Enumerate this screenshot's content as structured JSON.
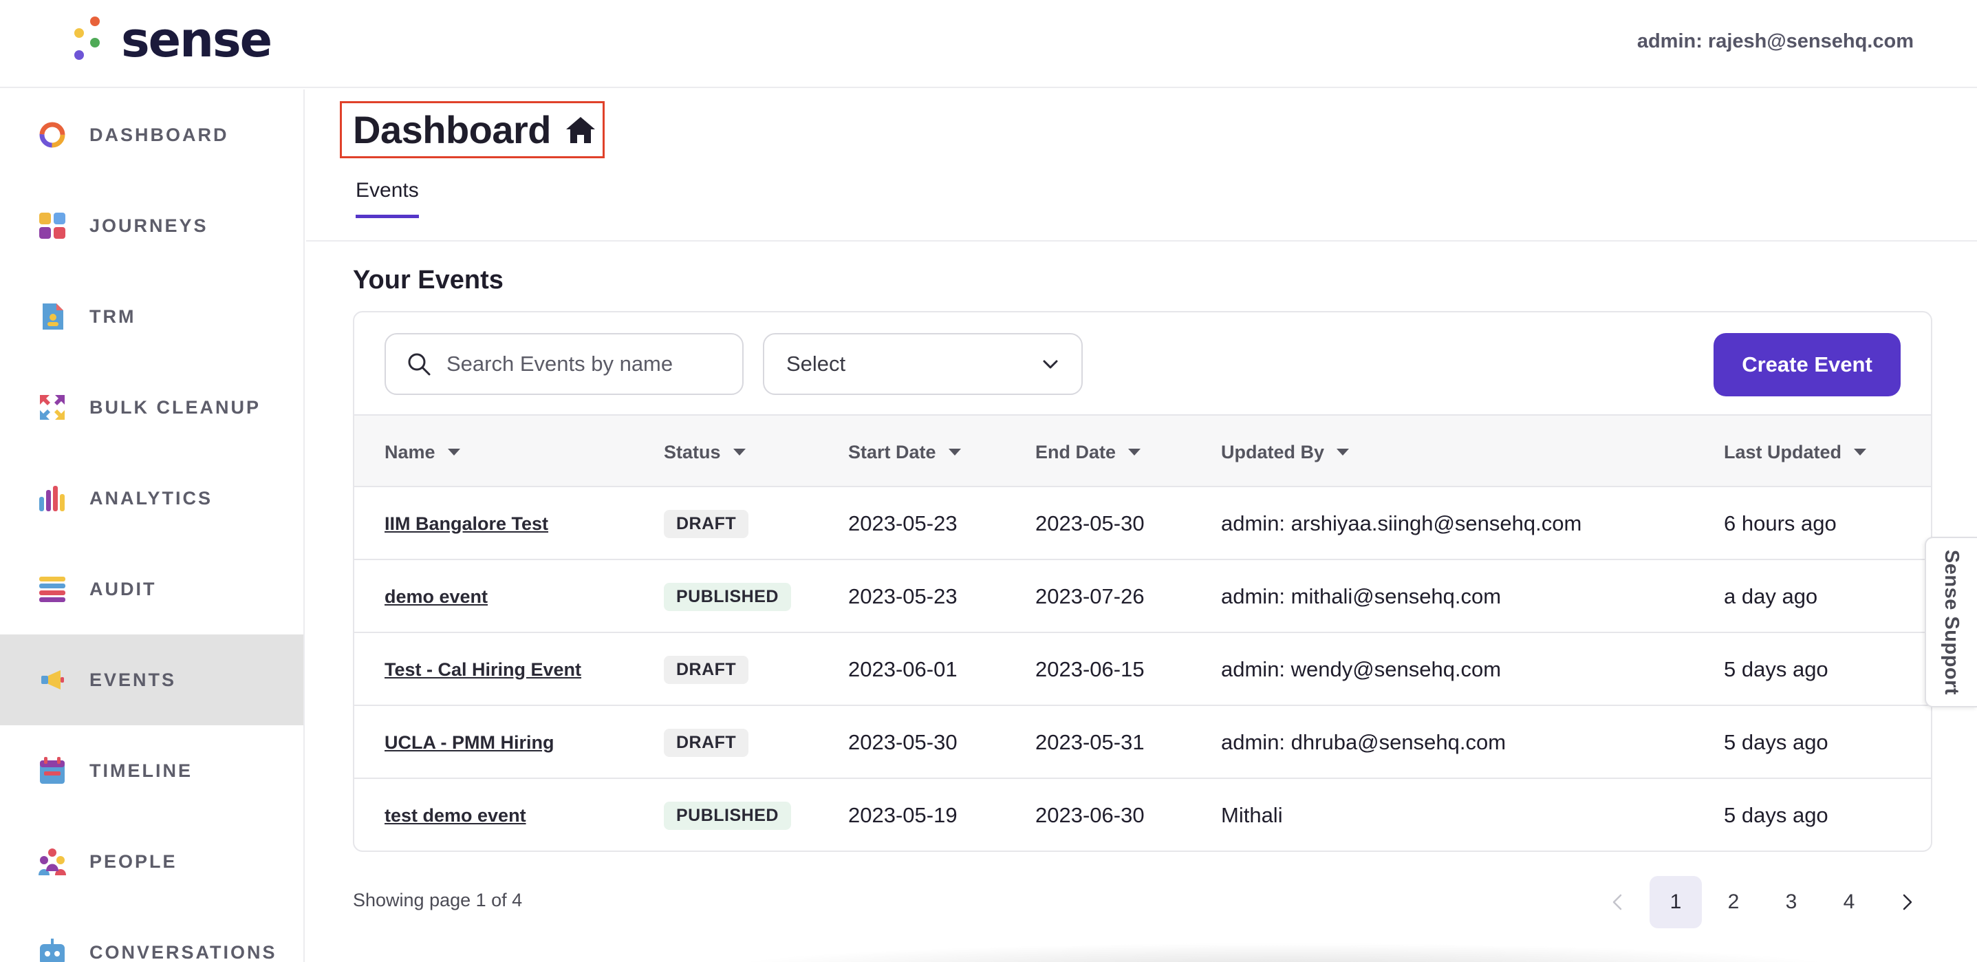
{
  "header": {
    "logo_text": "sense",
    "user": "admin: rajesh@sensehq.com"
  },
  "sidebar": {
    "items": [
      {
        "label": "DASHBOARD",
        "icon": "dashboard-ring-icon"
      },
      {
        "label": "JOURNEYS",
        "icon": "journeys-grid-icon"
      },
      {
        "label": "TRM",
        "icon": "trm-document-icon"
      },
      {
        "label": "BULK CLEANUP",
        "icon": "bulk-cleanup-arrows-icon"
      },
      {
        "label": "ANALYTICS",
        "icon": "analytics-bars-icon"
      },
      {
        "label": "AUDIT",
        "icon": "audit-list-icon"
      },
      {
        "label": "EVENTS",
        "icon": "events-megaphone-icon",
        "active": true
      },
      {
        "label": "TIMELINE",
        "icon": "timeline-calendar-icon"
      },
      {
        "label": "PEOPLE",
        "icon": "people-group-icon"
      },
      {
        "label": "CONVERSATIONS",
        "icon": "conversations-bot-icon"
      }
    ]
  },
  "page": {
    "title": "Dashboard",
    "tabs": [
      {
        "label": "Events"
      }
    ],
    "section_title": "Your Events"
  },
  "toolbar": {
    "search_placeholder": "Search Events by name",
    "select_value": "Select",
    "create_label": "Create Event"
  },
  "table": {
    "columns": [
      "Name",
      "Status",
      "Start Date",
      "End Date",
      "Updated By",
      "Last Updated"
    ],
    "rows": [
      {
        "name": "IIM Bangalore Test",
        "status": "DRAFT",
        "start": "2023-05-23",
        "end": "2023-05-30",
        "updated_by": "admin: arshiyaa.siingh@sensehq.com",
        "last_updated": "6 hours ago"
      },
      {
        "name": "demo event",
        "status": "PUBLISHED",
        "start": "2023-05-23",
        "end": "2023-07-26",
        "updated_by": "admin: mithali@sensehq.com",
        "last_updated": "a day ago"
      },
      {
        "name": "Test - Cal Hiring Event",
        "status": "DRAFT",
        "start": "2023-06-01",
        "end": "2023-06-15",
        "updated_by": "admin: wendy@sensehq.com",
        "last_updated": "5 days ago"
      },
      {
        "name": "UCLA - PMM Hiring",
        "status": "DRAFT",
        "start": "2023-05-30",
        "end": "2023-05-31",
        "updated_by": "admin: dhruba@sensehq.com",
        "last_updated": "5 days ago"
      },
      {
        "name": "test demo event",
        "status": "PUBLISHED",
        "start": "2023-05-19",
        "end": "2023-06-30",
        "updated_by": "Mithali",
        "last_updated": "5 days ago"
      }
    ]
  },
  "pagination": {
    "summary": "Showing page 1 of 4",
    "pages": [
      "1",
      "2",
      "3",
      "4"
    ],
    "current": "1"
  },
  "support": {
    "label": "Sense Support"
  },
  "colors": {
    "accent": "#5536c8",
    "title_highlight": "#e0412a",
    "active_nav": "#e2e2e2",
    "draft_badge": "#efefef",
    "published_badge": "#e8f4ec"
  }
}
